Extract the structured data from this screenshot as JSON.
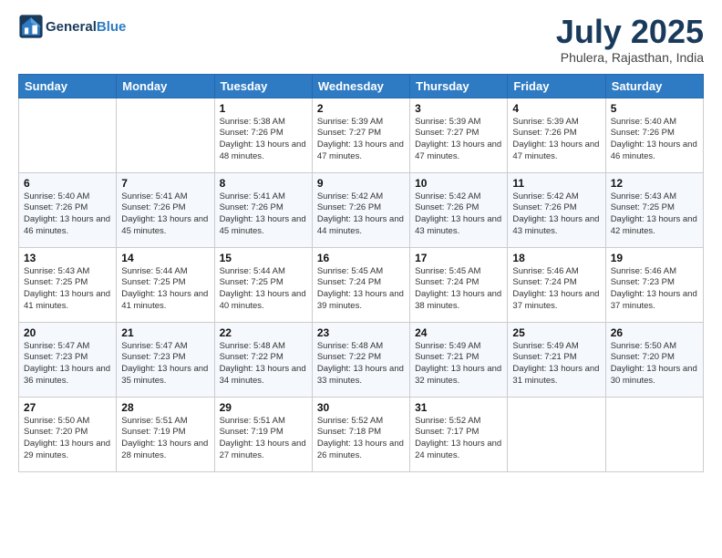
{
  "header": {
    "logo_line1": "General",
    "logo_line2": "Blue",
    "month": "July 2025",
    "location": "Phulera, Rajasthan, India"
  },
  "days_of_week": [
    "Sunday",
    "Monday",
    "Tuesday",
    "Wednesday",
    "Thursday",
    "Friday",
    "Saturday"
  ],
  "weeks": [
    [
      {
        "day": "",
        "info": ""
      },
      {
        "day": "",
        "info": ""
      },
      {
        "day": "1",
        "info": "Sunrise: 5:38 AM\nSunset: 7:26 PM\nDaylight: 13 hours and 48 minutes."
      },
      {
        "day": "2",
        "info": "Sunrise: 5:39 AM\nSunset: 7:27 PM\nDaylight: 13 hours and 47 minutes."
      },
      {
        "day": "3",
        "info": "Sunrise: 5:39 AM\nSunset: 7:27 PM\nDaylight: 13 hours and 47 minutes."
      },
      {
        "day": "4",
        "info": "Sunrise: 5:39 AM\nSunset: 7:26 PM\nDaylight: 13 hours and 47 minutes."
      },
      {
        "day": "5",
        "info": "Sunrise: 5:40 AM\nSunset: 7:26 PM\nDaylight: 13 hours and 46 minutes."
      }
    ],
    [
      {
        "day": "6",
        "info": "Sunrise: 5:40 AM\nSunset: 7:26 PM\nDaylight: 13 hours and 46 minutes."
      },
      {
        "day": "7",
        "info": "Sunrise: 5:41 AM\nSunset: 7:26 PM\nDaylight: 13 hours and 45 minutes."
      },
      {
        "day": "8",
        "info": "Sunrise: 5:41 AM\nSunset: 7:26 PM\nDaylight: 13 hours and 45 minutes."
      },
      {
        "day": "9",
        "info": "Sunrise: 5:42 AM\nSunset: 7:26 PM\nDaylight: 13 hours and 44 minutes."
      },
      {
        "day": "10",
        "info": "Sunrise: 5:42 AM\nSunset: 7:26 PM\nDaylight: 13 hours and 43 minutes."
      },
      {
        "day": "11",
        "info": "Sunrise: 5:42 AM\nSunset: 7:26 PM\nDaylight: 13 hours and 43 minutes."
      },
      {
        "day": "12",
        "info": "Sunrise: 5:43 AM\nSunset: 7:25 PM\nDaylight: 13 hours and 42 minutes."
      }
    ],
    [
      {
        "day": "13",
        "info": "Sunrise: 5:43 AM\nSunset: 7:25 PM\nDaylight: 13 hours and 41 minutes."
      },
      {
        "day": "14",
        "info": "Sunrise: 5:44 AM\nSunset: 7:25 PM\nDaylight: 13 hours and 41 minutes."
      },
      {
        "day": "15",
        "info": "Sunrise: 5:44 AM\nSunset: 7:25 PM\nDaylight: 13 hours and 40 minutes."
      },
      {
        "day": "16",
        "info": "Sunrise: 5:45 AM\nSunset: 7:24 PM\nDaylight: 13 hours and 39 minutes."
      },
      {
        "day": "17",
        "info": "Sunrise: 5:45 AM\nSunset: 7:24 PM\nDaylight: 13 hours and 38 minutes."
      },
      {
        "day": "18",
        "info": "Sunrise: 5:46 AM\nSunset: 7:24 PM\nDaylight: 13 hours and 37 minutes."
      },
      {
        "day": "19",
        "info": "Sunrise: 5:46 AM\nSunset: 7:23 PM\nDaylight: 13 hours and 37 minutes."
      }
    ],
    [
      {
        "day": "20",
        "info": "Sunrise: 5:47 AM\nSunset: 7:23 PM\nDaylight: 13 hours and 36 minutes."
      },
      {
        "day": "21",
        "info": "Sunrise: 5:47 AM\nSunset: 7:23 PM\nDaylight: 13 hours and 35 minutes."
      },
      {
        "day": "22",
        "info": "Sunrise: 5:48 AM\nSunset: 7:22 PM\nDaylight: 13 hours and 34 minutes."
      },
      {
        "day": "23",
        "info": "Sunrise: 5:48 AM\nSunset: 7:22 PM\nDaylight: 13 hours and 33 minutes."
      },
      {
        "day": "24",
        "info": "Sunrise: 5:49 AM\nSunset: 7:21 PM\nDaylight: 13 hours and 32 minutes."
      },
      {
        "day": "25",
        "info": "Sunrise: 5:49 AM\nSunset: 7:21 PM\nDaylight: 13 hours and 31 minutes."
      },
      {
        "day": "26",
        "info": "Sunrise: 5:50 AM\nSunset: 7:20 PM\nDaylight: 13 hours and 30 minutes."
      }
    ],
    [
      {
        "day": "27",
        "info": "Sunrise: 5:50 AM\nSunset: 7:20 PM\nDaylight: 13 hours and 29 minutes."
      },
      {
        "day": "28",
        "info": "Sunrise: 5:51 AM\nSunset: 7:19 PM\nDaylight: 13 hours and 28 minutes."
      },
      {
        "day": "29",
        "info": "Sunrise: 5:51 AM\nSunset: 7:19 PM\nDaylight: 13 hours and 27 minutes."
      },
      {
        "day": "30",
        "info": "Sunrise: 5:52 AM\nSunset: 7:18 PM\nDaylight: 13 hours and 26 minutes."
      },
      {
        "day": "31",
        "info": "Sunrise: 5:52 AM\nSunset: 7:17 PM\nDaylight: 13 hours and 24 minutes."
      },
      {
        "day": "",
        "info": ""
      },
      {
        "day": "",
        "info": ""
      }
    ]
  ]
}
